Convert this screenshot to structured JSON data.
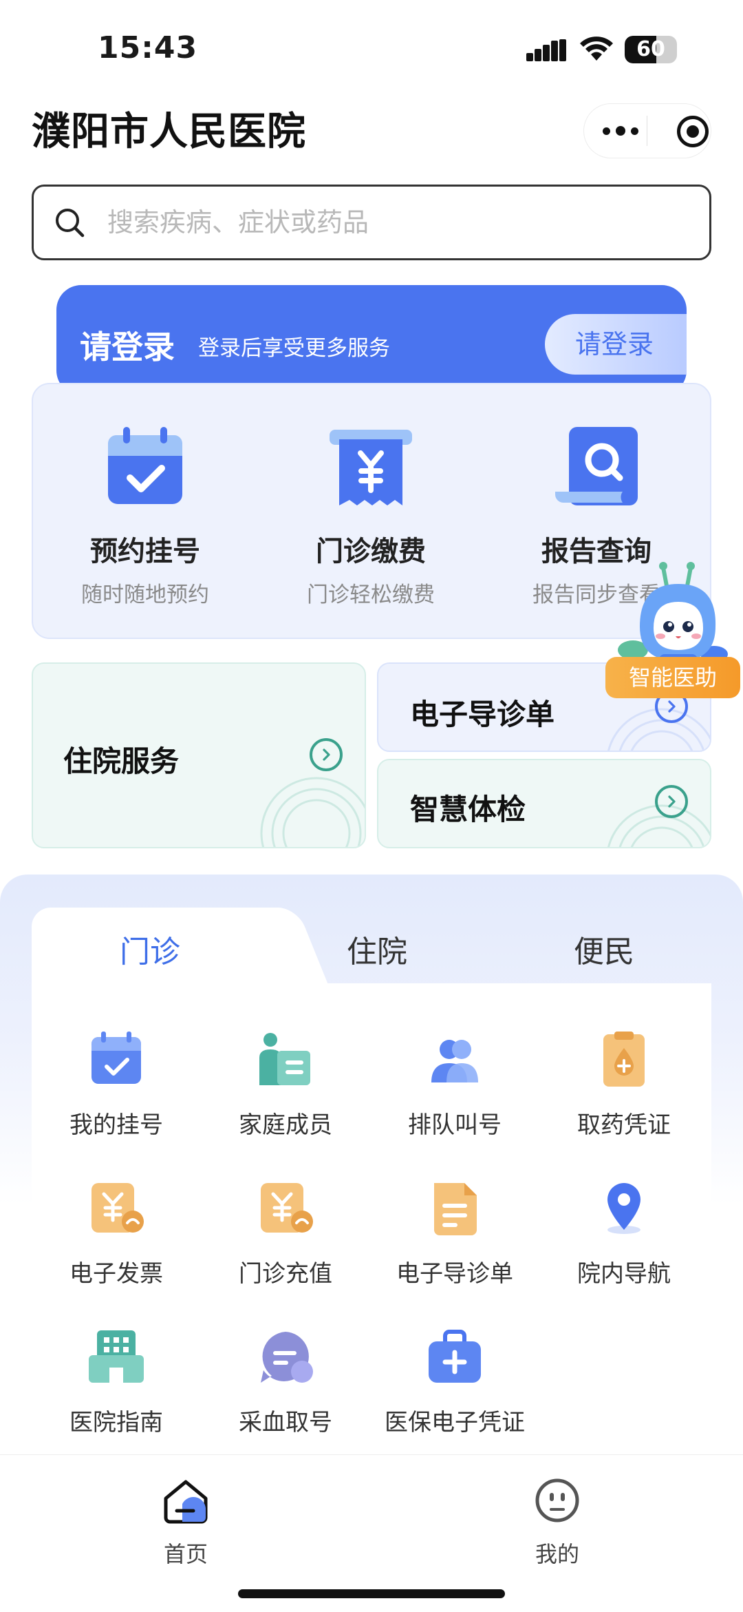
{
  "status_bar": {
    "time": "15:43",
    "battery": "60"
  },
  "header": {
    "title": "濮阳市人民医院"
  },
  "search": {
    "placeholder": "搜索疾病、症状或药品"
  },
  "login_banner": {
    "title": "请登录",
    "subtitle": "登录后享受更多服务",
    "button_label": "请登录"
  },
  "services": [
    {
      "label": "预约挂号",
      "sub": "随时随地预约",
      "icon": "calendar-check-icon"
    },
    {
      "label": "门诊缴费",
      "sub": "门诊轻松缴费",
      "icon": "yuan-receipt-icon"
    },
    {
      "label": "报告查询",
      "sub": "报告同步查看",
      "icon": "report-search-icon"
    }
  ],
  "assistant": {
    "label": "智能医助"
  },
  "quick_cards": {
    "inpatient": "住院服务",
    "e_guide": "电子导诊单",
    "checkup": "智慧体检"
  },
  "tabs": [
    {
      "label": "门诊",
      "active": true
    },
    {
      "label": "住院",
      "active": false
    },
    {
      "label": "便民",
      "active": false
    }
  ],
  "grid": [
    {
      "label": "我的挂号",
      "icon": "calendar-icon"
    },
    {
      "label": "家庭成员",
      "icon": "family-member-icon"
    },
    {
      "label": "排队叫号",
      "icon": "queue-icon"
    },
    {
      "label": "取药凭证",
      "icon": "medicine-voucher-icon"
    },
    {
      "label": "电子发票",
      "icon": "invoice-icon"
    },
    {
      "label": "门诊充值",
      "icon": "recharge-icon"
    },
    {
      "label": "电子导诊单",
      "icon": "guide-document-icon"
    },
    {
      "label": "院内导航",
      "icon": "location-pin-icon"
    },
    {
      "label": "医院指南",
      "icon": "hospital-building-icon"
    },
    {
      "label": "采血取号",
      "icon": "blood-ticket-icon"
    },
    {
      "label": "医保电子凭证",
      "icon": "medical-insurance-icon"
    }
  ],
  "bottom_nav": [
    {
      "label": "首页",
      "icon": "home-icon",
      "active": true
    },
    {
      "label": "我的",
      "icon": "profile-icon",
      "active": false
    }
  ],
  "colors": {
    "primary": "#4a74ef",
    "tab_active": "#3e6ee8",
    "accent_green": "#3aa18c",
    "assistant_orange": "#f5a234",
    "icon_orange": "#f0b45b",
    "icon_teal": "#4bb1a2"
  }
}
